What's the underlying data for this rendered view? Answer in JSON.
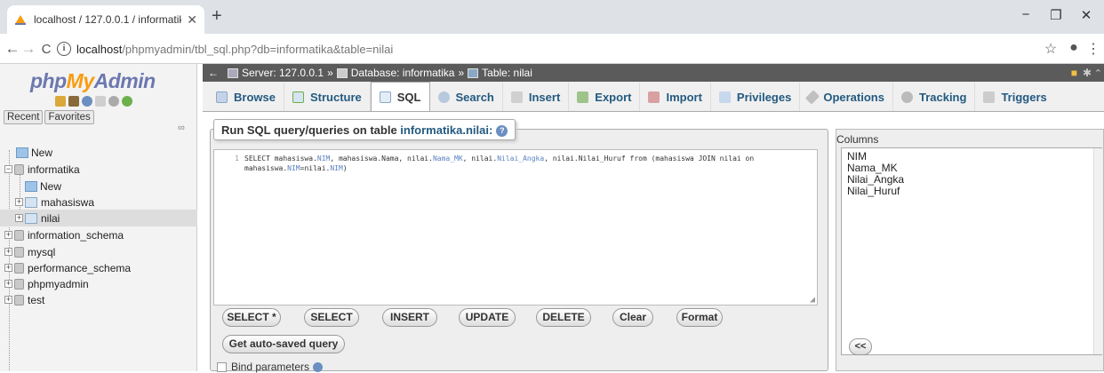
{
  "browser": {
    "tab_title": "localhost / 127.0.0.1 / informatik",
    "new_tab": "+",
    "url_host": "localhost",
    "url_rest": "/phpmyadmin/tbl_sql.php?db=informatika&table=nilai",
    "info_icon": "i",
    "close_tab": "✕",
    "minimize": "−",
    "restore": "❐",
    "close": "✕",
    "back": "←",
    "forward": "→",
    "reload": "C",
    "star": "☆",
    "account": "●",
    "menu": "⋮"
  },
  "sidebar": {
    "logo_php": "php",
    "logo_my": "My",
    "logo_admin": "Admin",
    "recent": "Recent",
    "favorites": "Favorites",
    "link_icon": "∞",
    "tree": [
      {
        "label": "New"
      },
      {
        "label": "informatika"
      },
      {
        "label": "New"
      },
      {
        "label": "mahasiswa"
      },
      {
        "label": "nilai"
      },
      {
        "label": "information_schema"
      },
      {
        "label": "mysql"
      },
      {
        "label": "performance_schema"
      },
      {
        "label": "phpmyadmin"
      },
      {
        "label": "test"
      }
    ]
  },
  "breadcrumb": {
    "server": "Server: 127.0.0.1",
    "database": "Database: informatika",
    "table": "Table: nilai",
    "separator": "»"
  },
  "tabs": [
    {
      "label": "Browse",
      "icon": "browse-icon"
    },
    {
      "label": "Structure",
      "icon": "structure-icon"
    },
    {
      "label": "SQL",
      "icon": "sql-icon"
    },
    {
      "label": "Search",
      "icon": "search-icon"
    },
    {
      "label": "Insert",
      "icon": "insert-icon"
    },
    {
      "label": "Export",
      "icon": "export-icon"
    },
    {
      "label": "Import",
      "icon": "import-icon"
    },
    {
      "label": "Privileges",
      "icon": "privileges-icon"
    },
    {
      "label": "Operations",
      "icon": "operations-icon"
    },
    {
      "label": "Tracking",
      "icon": "tracking-icon"
    },
    {
      "label": "Triggers",
      "icon": "triggers-icon"
    }
  ],
  "sql": {
    "legend_prefix": "Run SQL query/queries on table ",
    "legend_table": "informatika.nilai:",
    "line_number": "1",
    "query": {
      "p1": "SELECT mahasiswa.",
      "c1": "NIM",
      "p2": ", mahasiswa.Nama, nilai.",
      "c2": "Nama_MK",
      "p3": ", nilai.",
      "c3": "Nilai_Angka",
      "p4": ", nilai.Nilai_Huruf from (mahasiswa JOIN nilai on",
      "p5": "mahasiswa.",
      "c4": "NIM",
      "p6": "=nilai.",
      "c5": "NIM",
      "p7": ")"
    },
    "buttons": {
      "select_star": "SELECT *",
      "select": "SELECT",
      "insert": "INSERT",
      "update": "UPDATE",
      "delete": "DELETE",
      "clear": "Clear",
      "format": "Format"
    },
    "get_auto_saved": "Get auto-saved query",
    "bind_parameters": "Bind parameters"
  },
  "columns": {
    "label": "Columns",
    "items": [
      "NIM",
      "Nama_MK",
      "Nilai_Angka",
      "Nilai_Huruf"
    ],
    "insert_button": "<<"
  },
  "colors": {
    "accent": "#235a81",
    "breadcrumb_bg": "#5b5b5b"
  }
}
